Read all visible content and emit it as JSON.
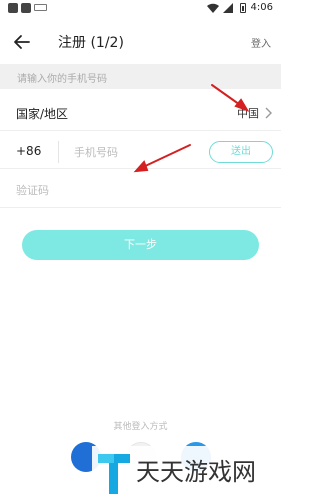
{
  "status_bar": {
    "time": "4:06"
  },
  "header": {
    "title": "注册 (1/2)",
    "login": "登入"
  },
  "hint": "请输入你的手机号码",
  "country_row": {
    "label": "国家/地区",
    "value": "中国"
  },
  "phone_row": {
    "country_code": "+86",
    "placeholder": "手机号码",
    "send_button": "送出"
  },
  "code_row": {
    "placeholder": "验证码"
  },
  "next_button": "下一步",
  "other_login": {
    "label": "其他登入方式"
  },
  "watermark": {
    "text": "天天游戏网"
  },
  "colors": {
    "accent": "#7ee9e2",
    "annotation": "#d42020"
  }
}
